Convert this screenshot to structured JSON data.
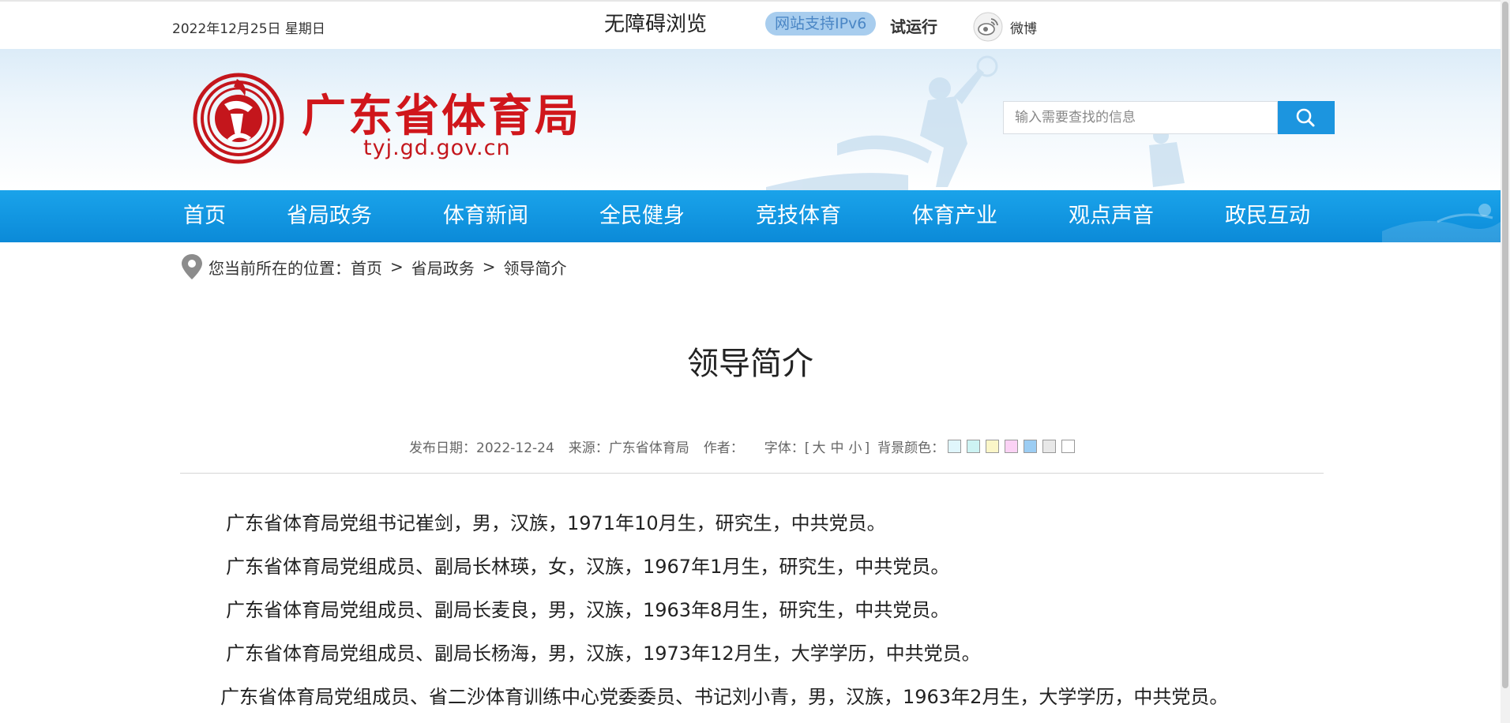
{
  "topbar": {
    "date": "2022年12月25日 星期日",
    "accessibility": "无障碍浏览",
    "ipv6_badge": "网站支持IPv6",
    "trial": "试运行",
    "weibo": "微博"
  },
  "header": {
    "site_title": "广东省体育局",
    "site_url": "tyj.gd.gov.cn",
    "search_placeholder": "输入需要查找的信息"
  },
  "nav": {
    "items": [
      {
        "label": "首页"
      },
      {
        "label": "省局政务"
      },
      {
        "label": "体育新闻"
      },
      {
        "label": "全民健身"
      },
      {
        "label": "竞技体育"
      },
      {
        "label": "体育产业"
      },
      {
        "label": "观点声音"
      },
      {
        "label": "政民互动"
      }
    ]
  },
  "breadcrumb": {
    "prefix": "您当前所在的位置：",
    "items": [
      "首页",
      "省局政务",
      "领导简介"
    ],
    "separator": ">"
  },
  "article": {
    "title": "领导简介",
    "publish_date": "发布日期：2022-12-24",
    "source": "来源：广东省体育局",
    "author": "作者：",
    "font_label": "字体：[",
    "font_large": "大",
    "font_medium": "中",
    "font_small": "小",
    "font_end": "]",
    "bg_label": "背景颜色：",
    "bg_colors": [
      "#e0f6fc",
      "#cdf3f3",
      "#fbf6c8",
      "#fbd2f5",
      "#9ccdf3",
      "#e8e8e8",
      "#ffffff"
    ],
    "paragraphs": [
      "广东省体育局党组书记崔剑，男，汉族，1971年10月生，研究生，中共党员。",
      "广东省体育局党组成员、副局长林瑛，女，汉族，1967年1月生，研究生，中共党员。",
      "广东省体育局党组成员、副局长麦良，男，汉族，1963年8月生，研究生，中共党员。",
      "广东省体育局党组成员、副局长杨海，男，汉族，1973年12月生，大学学历，中共党员。",
      "广东省体育局党组成员、省二沙体育训练中心党委委员、书记刘小青，男，汉族，1963年2月生，大学学历，中共党员。"
    ]
  },
  "colors": {
    "brand_red": "#d0161b",
    "nav_blue": "#1aa3ea",
    "search_button": "#1c95df"
  }
}
